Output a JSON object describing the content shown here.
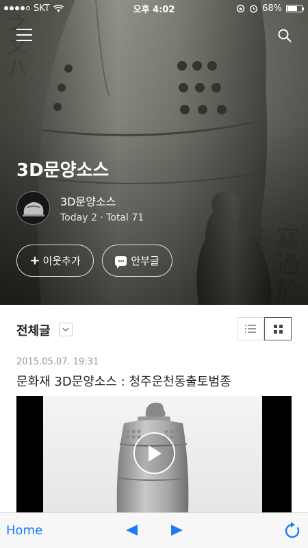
{
  "status_bar": {
    "carrier": "SKT",
    "time": "오후 4:02",
    "battery": "68%",
    "battery_level": 0.68
  },
  "hero": {
    "blog_title": "3D문양소스",
    "profile_name": "3D문양소스",
    "stats": "Today 2 · Total 71",
    "add_neighbor_label": "이웃추가",
    "guestbook_label": "안부글"
  },
  "content": {
    "section_title": "전체글",
    "post": {
      "date": "2015.05.07. 19:31",
      "title": "문화재 3D문양소스 : 청주운천동출토범종"
    }
  },
  "toolbar": {
    "home_label": "Home"
  },
  "colors": {
    "accent": "#1a7cf6",
    "toolbar_bg": "#f7f7f8"
  },
  "icons": [
    "menu-icon",
    "search-icon",
    "dropdown-chevron-icon",
    "list-view-icon",
    "grid-view-icon",
    "play-icon",
    "back-arrow-icon",
    "forward-arrow-icon",
    "reload-icon"
  ]
}
